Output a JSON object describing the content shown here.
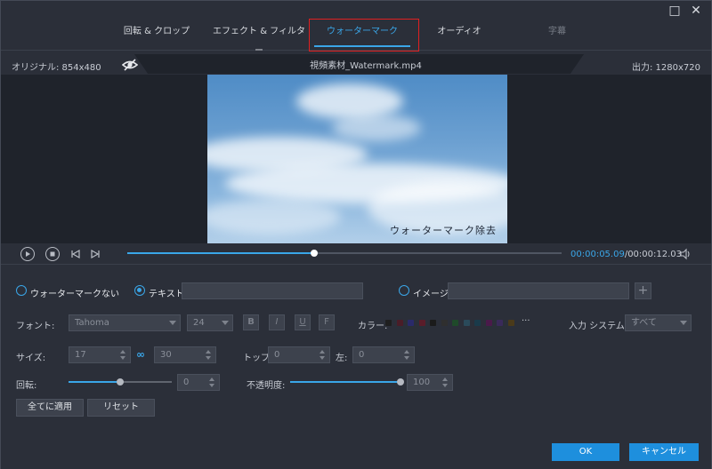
{
  "window": {
    "minimize_icon": "□",
    "close_icon": "✕"
  },
  "tabs": [
    {
      "label": "回転 & クロップ"
    },
    {
      "label": "エフェクト & フィルター"
    },
    {
      "label": "ウォーターマーク"
    },
    {
      "label": "オーディオ"
    },
    {
      "label": "字幕"
    }
  ],
  "info": {
    "original": "オリジナル: 854x480",
    "filename": "視頻素材_Watermark.mp4",
    "output": "出力: 1280x720"
  },
  "video": {
    "watermark_text": "ウォーターマーク除去"
  },
  "playback": {
    "current_time": "00:00:05.09",
    "total_time": "/00:00:12.03",
    "progress_fraction": 0.43
  },
  "watermark": {
    "none_label": "ウォーターマークない",
    "text_label": "テキスト",
    "text_value": "",
    "image_label": "イメージ",
    "image_value": ""
  },
  "font": {
    "label": "フォント:",
    "family": "Tahoma",
    "size": "24",
    "bold": "B",
    "italic": "I",
    "underline": "U",
    "strike": "F",
    "color_label": "カラー:",
    "more": "···",
    "input_system_label": "入力 システム:",
    "input_system_value": "すべて"
  },
  "colors": [
    "#1f1f1f",
    "#4a1d28",
    "#2a2a6a",
    "#5a1d2a",
    "#1b1b1b",
    "#2f2f2f",
    "#1f4a2a",
    "#2a4a5a",
    "#1a3a4a",
    "#4a1a4a",
    "#3a2a5a",
    "#4a3a1a"
  ],
  "size": {
    "label": "サイズ:",
    "width": "17",
    "height": "30",
    "top_label": "トップ:",
    "top_value": "0",
    "left_label": "左:",
    "left_value": "0"
  },
  "rotate": {
    "label": "回転:",
    "value": "0",
    "fraction": 0.0
  },
  "opacity": {
    "label": "不透明度:",
    "value": "100",
    "fraction": 1.0
  },
  "buttons": {
    "apply_all": "全てに適用",
    "reset": "リセット",
    "ok": "OK",
    "cancel": "キャンセル"
  }
}
